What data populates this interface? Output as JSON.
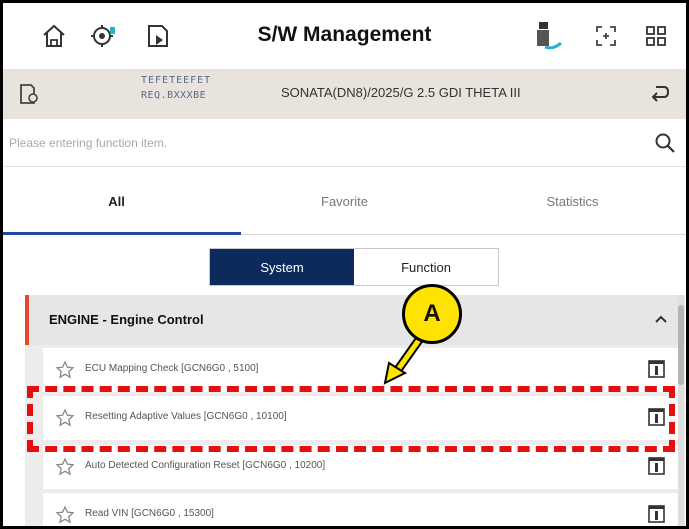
{
  "header": {
    "title": "S/W Management",
    "icons": [
      "home-icon",
      "vehicle-diagnostics-icon",
      "document-export-icon",
      "vci-status-icon",
      "fullscreen-icon",
      "grid-menu-icon"
    ]
  },
  "vehicle": {
    "meta_line1": "TEFETEEFET",
    "meta_line2": "REQ.BXXXBE",
    "description": "SONATA(DN8)/2025/G 2.5 GDI THETA III",
    "icons": [
      "vehicle-settings-icon",
      "return-icon"
    ]
  },
  "search": {
    "placeholder": "Please entering function item."
  },
  "tabs": [
    {
      "label": "All",
      "active": true
    },
    {
      "label": "Favorite",
      "active": false
    },
    {
      "label": "Statistics",
      "active": false
    }
  ],
  "segment": {
    "system": "System",
    "function": "Function",
    "selected": "System"
  },
  "section": {
    "title": "ENGINE - Engine Control",
    "expanded": true,
    "accent_color": "#e14b2c"
  },
  "items": [
    {
      "label": "ECU Mapping Check [GCN6G0 , 5100]"
    },
    {
      "label": "Resetting Adaptive Values [GCN6G0 , 10100]"
    },
    {
      "label": "Auto Detected Configuration Reset [GCN6G0 , 10200]"
    },
    {
      "label": "Read VIN [GCN6G0 , 15300]"
    }
  ],
  "annotation": {
    "callout_label": "A",
    "callout_color": "#ffe300",
    "highlight_color": "#e60f0f"
  },
  "colors": {
    "primary": "#0d2a5c",
    "tab_underline": "#1f4aa0",
    "vehicle_bar": "#e9e3de"
  }
}
